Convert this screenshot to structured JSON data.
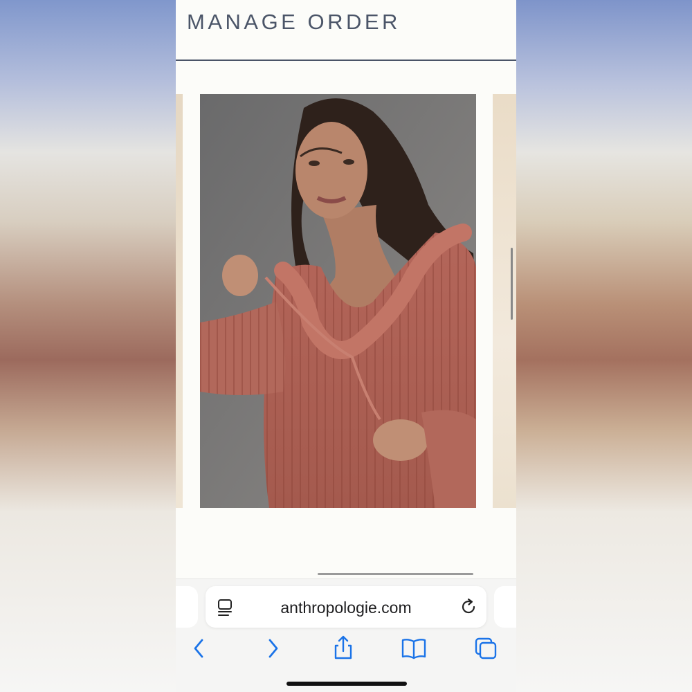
{
  "page": {
    "title": "MANAGE ORDER"
  },
  "product": {
    "image_icon": "product-photo-ruffled-blouse"
  },
  "browser": {
    "url": "anthropologie.com",
    "icons": {
      "reader": "reader-mode-icon",
      "reload": "reload-icon",
      "back": "back-chevron-icon",
      "forward": "forward-chevron-icon",
      "share": "share-icon",
      "bookmarks": "bookmarks-icon",
      "tabs": "tabs-icon"
    },
    "accent_color": "#1a73e8"
  }
}
